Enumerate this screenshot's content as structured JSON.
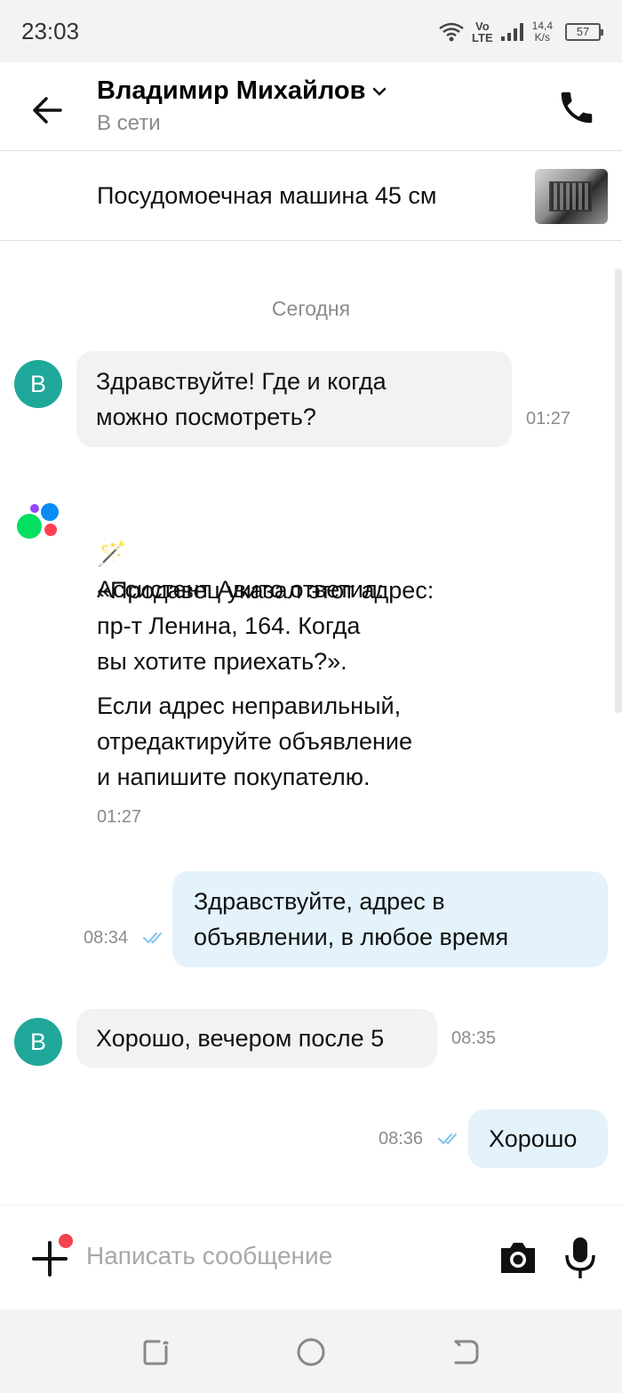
{
  "status_bar": {
    "time": "23:03",
    "volte_top": "Vo",
    "volte_bottom": "LTE",
    "speed_value": "14,4",
    "speed_unit": "K/s",
    "battery": "57"
  },
  "header": {
    "contact_name": "Владимир Михайлов",
    "contact_status": "В сети"
  },
  "item": {
    "title": "Посудомоечная машина 45 см"
  },
  "chat": {
    "date_separator": "Сегодня",
    "messages": [
      {
        "from": "buyer",
        "avatar_letter": "В",
        "text": "Здравствуйте! Где и когда\nможно посмотреть?",
        "time": "01:27"
      },
      {
        "from": "assistant",
        "header_emoji": "🪄",
        "header": "Ассистент Авито ответил:",
        "quote": "«Продавец указал этот адрес:\nпр-т Ленина, 164. Когда\nвы хотите приехать?».",
        "note": "Если адрес неправильный,\nотредактируйте объявление\nи напишите покупателю.",
        "time": "01:27"
      },
      {
        "from": "me",
        "text": "Здравствуйте, адрес в\nобъявлении, в любое время",
        "time": "08:34",
        "status": "read"
      },
      {
        "from": "buyer",
        "avatar_letter": "В",
        "text": "Хорошо, вечером после 5",
        "time": "08:35"
      },
      {
        "from": "me",
        "text": "Хорошо",
        "time": "08:36",
        "status": "read"
      }
    ]
  },
  "input": {
    "placeholder": "Написать сообщение"
  },
  "colors": {
    "avatar_bg": "#1fa89a",
    "outgoing_bubble": "#e3f2fb",
    "incoming_bubble": "#f2f2f2",
    "read_ticks": "#7ec4e8",
    "notification_dot": "#f4434f"
  },
  "icons": [
    "back-arrow-icon",
    "chevron-down-icon",
    "phone-icon",
    "avito-logo-icon",
    "double-check-icon",
    "plus-icon",
    "camera-icon",
    "microphone-icon",
    "nav-recents-icon",
    "nav-home-icon",
    "nav-back-icon"
  ]
}
